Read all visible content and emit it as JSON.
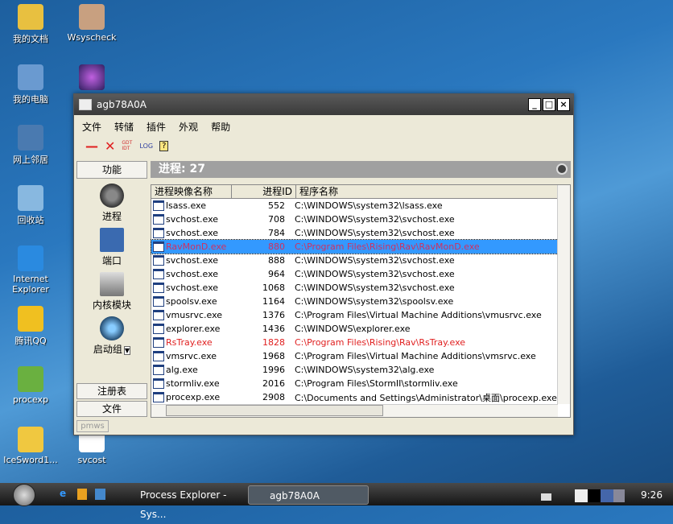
{
  "desktop": [
    "我的文档",
    "Wsyscheck",
    "我的电脑",
    "网上邻居",
    "回收站",
    "Internet Explorer",
    "腾讯QQ",
    "procexp",
    "IceSword1...",
    "svcost"
  ],
  "window": {
    "title": "agb78A0A",
    "menu": [
      "文件",
      "转储",
      "插件",
      "外观",
      "帮助"
    ],
    "toolbar": {
      "gdt_idt": "GDT IDT",
      "log": "LOG"
    }
  },
  "left_panel": {
    "header": "功能",
    "items": [
      "进程",
      "端口",
      "内核模块",
      "启动组"
    ],
    "bottom": [
      "注册表",
      "文件"
    ]
  },
  "main": {
    "header": "进程: 27",
    "columns": [
      "进程映像名称",
      "进程ID",
      "程序名称"
    ],
    "rows": [
      [
        "lsass.exe",
        "552",
        "C:\\WINDOWS\\system32\\lsass.exe",
        ""
      ],
      [
        "svchost.exe",
        "708",
        "C:\\WINDOWS\\system32\\svchost.exe",
        ""
      ],
      [
        "svchost.exe",
        "784",
        "C:\\WINDOWS\\system32\\svchost.exe",
        ""
      ],
      [
        "RavMonD.exe",
        "880",
        "C:\\Program Files\\Rising\\Rav\\RavMonD.exe",
        "sel"
      ],
      [
        "svchost.exe",
        "888",
        "C:\\WINDOWS\\system32\\svchost.exe",
        ""
      ],
      [
        "svchost.exe",
        "964",
        "C:\\WINDOWS\\system32\\svchost.exe",
        ""
      ],
      [
        "svchost.exe",
        "1068",
        "C:\\WINDOWS\\system32\\svchost.exe",
        ""
      ],
      [
        "spoolsv.exe",
        "1164",
        "C:\\WINDOWS\\system32\\spoolsv.exe",
        ""
      ],
      [
        "vmusrvc.exe",
        "1376",
        "C:\\Program Files\\Virtual Machine Additions\\vmusrvc.exe",
        ""
      ],
      [
        "explorer.exe",
        "1436",
        "C:\\WINDOWS\\explorer.exe",
        ""
      ],
      [
        "RsTray.exe",
        "1828",
        "C:\\Program Files\\Rising\\Rav\\RsTray.exe",
        "red"
      ],
      [
        "vmsrvc.exe",
        "1968",
        "C:\\Program Files\\Virtual Machine Additions\\vmsrvc.exe",
        ""
      ],
      [
        "alg.exe",
        "1996",
        "C:\\WINDOWS\\system32\\alg.exe",
        ""
      ],
      [
        "stormliv.exe",
        "2016",
        "C:\\Program Files\\StormII\\stormliv.exe",
        ""
      ],
      [
        "procexp.exe",
        "2908",
        "C:\\Documents and Settings\\Administrator\\桌面\\procexp.exe",
        ""
      ]
    ]
  },
  "status": "pmws",
  "taskbar": {
    "tasks": [
      "Process Explorer - Sys...",
      "agb78A0A"
    ],
    "clock": "9:26"
  }
}
